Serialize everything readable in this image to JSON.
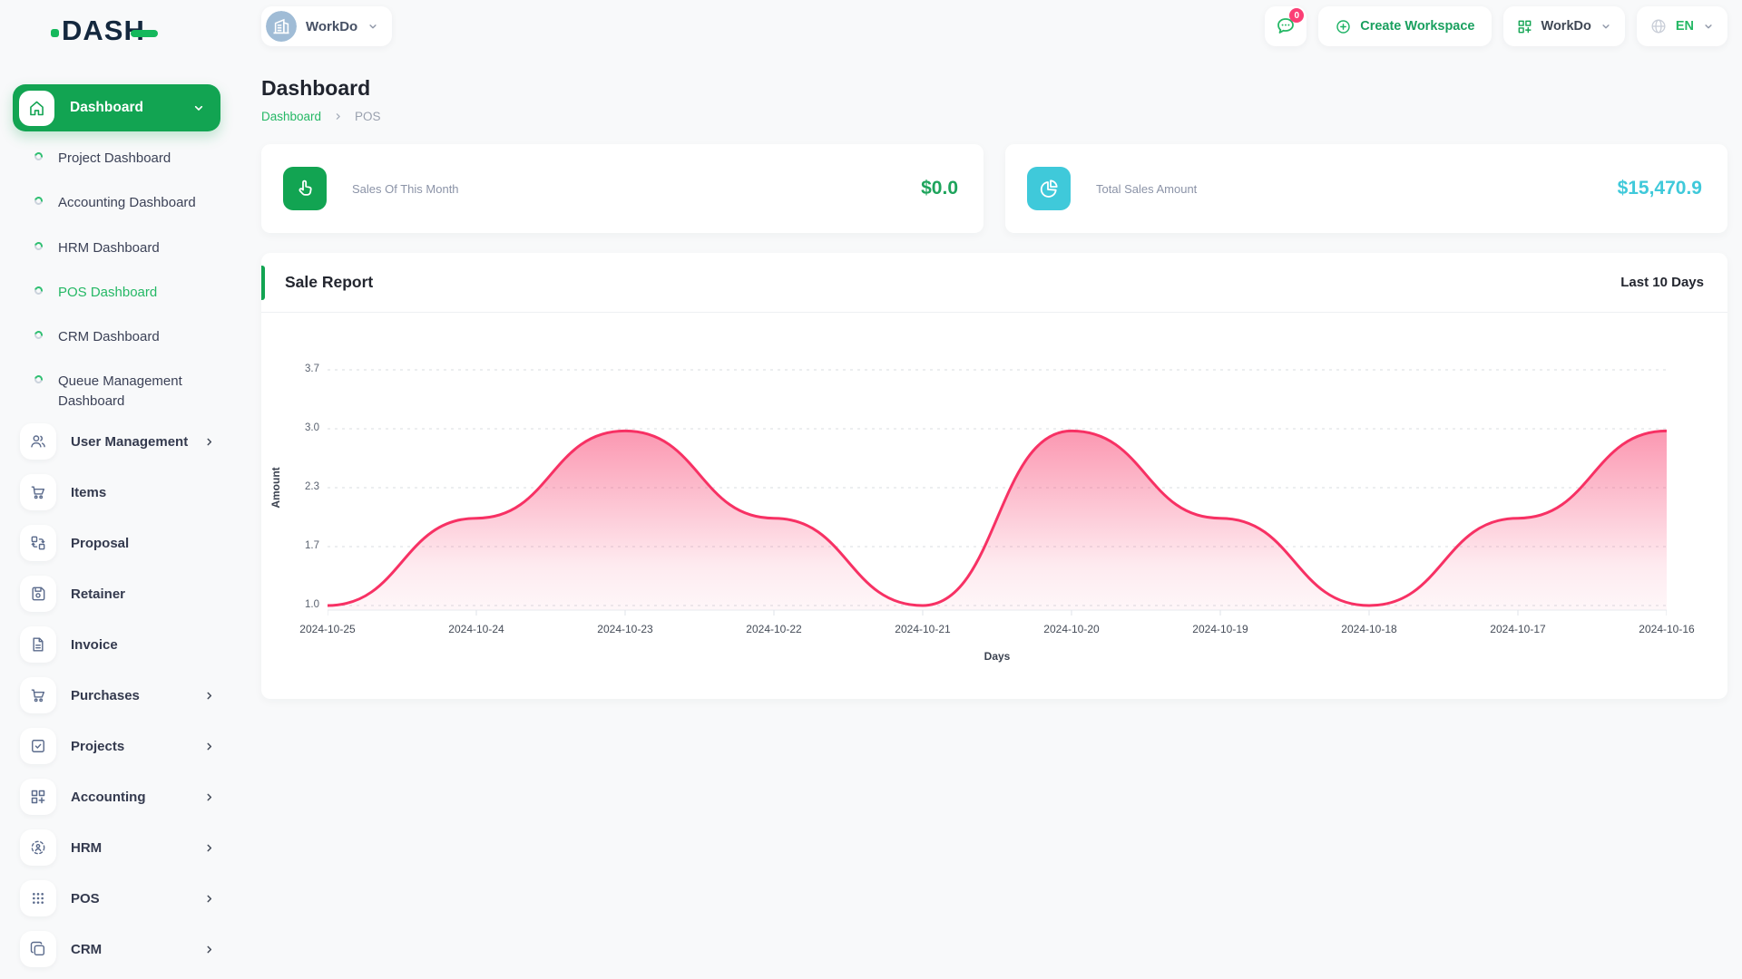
{
  "brand": {
    "logo_text": "DASH"
  },
  "topbar": {
    "workspace_switcher": {
      "label": "WorkDo",
      "avatar_icon": "building-icon"
    },
    "messages": {
      "icon": "chat-icon",
      "badge": "0"
    },
    "create_workspace_label": "Create Workspace",
    "workspace_dropdown_label": "WorkDo",
    "language": {
      "icon": "globe-icon",
      "code": "EN"
    }
  },
  "sidebar": {
    "dashboard_group": {
      "label": "Dashboard",
      "icon": "home-icon",
      "children": [
        "Project Dashboard",
        "Accounting Dashboard",
        "HRM Dashboard",
        "POS Dashboard",
        "CRM Dashboard",
        "Queue Management Dashboard"
      ],
      "active_child": "POS Dashboard"
    },
    "items": [
      {
        "label": "User Management",
        "icon": "users-icon",
        "expandable": true
      },
      {
        "label": "Items",
        "icon": "cart-icon",
        "expandable": false
      },
      {
        "label": "Proposal",
        "icon": "proposal-icon",
        "expandable": false
      },
      {
        "label": "Retainer",
        "icon": "retainer-icon",
        "expandable": false
      },
      {
        "label": "Invoice",
        "icon": "invoice-icon",
        "expandable": false
      },
      {
        "label": "Purchases",
        "icon": "cart-icon",
        "expandable": true
      },
      {
        "label": "Projects",
        "icon": "projects-icon",
        "expandable": true
      },
      {
        "label": "Accounting",
        "icon": "grid-plus-icon",
        "expandable": true
      },
      {
        "label": "HRM",
        "icon": "hrm-icon",
        "expandable": true
      },
      {
        "label": "POS",
        "icon": "dots-grid-icon",
        "expandable": true
      },
      {
        "label": "CRM",
        "icon": "squares-icon",
        "expandable": true
      }
    ]
  },
  "page": {
    "title": "Dashboard",
    "breadcrumb": {
      "link": "Dashboard",
      "current": "POS"
    }
  },
  "stats": [
    {
      "label": "Sales Of This Month",
      "value": "$0.0",
      "icon": "hand-pointer-icon",
      "tile_color": "#12a452",
      "value_color": "#1ea45c"
    },
    {
      "label": "Total Sales Amount",
      "value": "$15,470.9",
      "icon": "pie-chart-icon",
      "tile_color": "#3fc9da",
      "value_color": "#3fc9da"
    }
  ],
  "sale_report": {
    "title": "Sale Report",
    "range_label": "Last 10 Days"
  },
  "chart_data": {
    "type": "area",
    "title": "Sale Report",
    "x": [
      "2024-10-25",
      "2024-10-24",
      "2024-10-23",
      "2024-10-22",
      "2024-10-21",
      "2024-10-20",
      "2024-10-19",
      "2024-10-18",
      "2024-10-17",
      "2024-10-16"
    ],
    "series": [
      {
        "name": "Amount",
        "values": [
          1.0,
          2.0,
          3.0,
          2.0,
          1.0,
          3.0,
          2.0,
          1.0,
          2.0,
          3.0
        ]
      }
    ],
    "xlabel": "Days",
    "ylabel": "Amount",
    "y_ticks": [
      "1.0",
      "1.7",
      "2.3",
      "3.0",
      "3.7"
    ],
    "ylim": [
      1.0,
      3.7
    ],
    "curve": "smooth",
    "grid": true,
    "legend": false,
    "line_color": "#f73164",
    "fill_color": "#f73164"
  },
  "colors": {
    "primary_green": "#12a452",
    "link_green": "#25b865",
    "cyan": "#3fc9da",
    "pink": "#f73164",
    "badge_pink": "#fb3e75"
  }
}
